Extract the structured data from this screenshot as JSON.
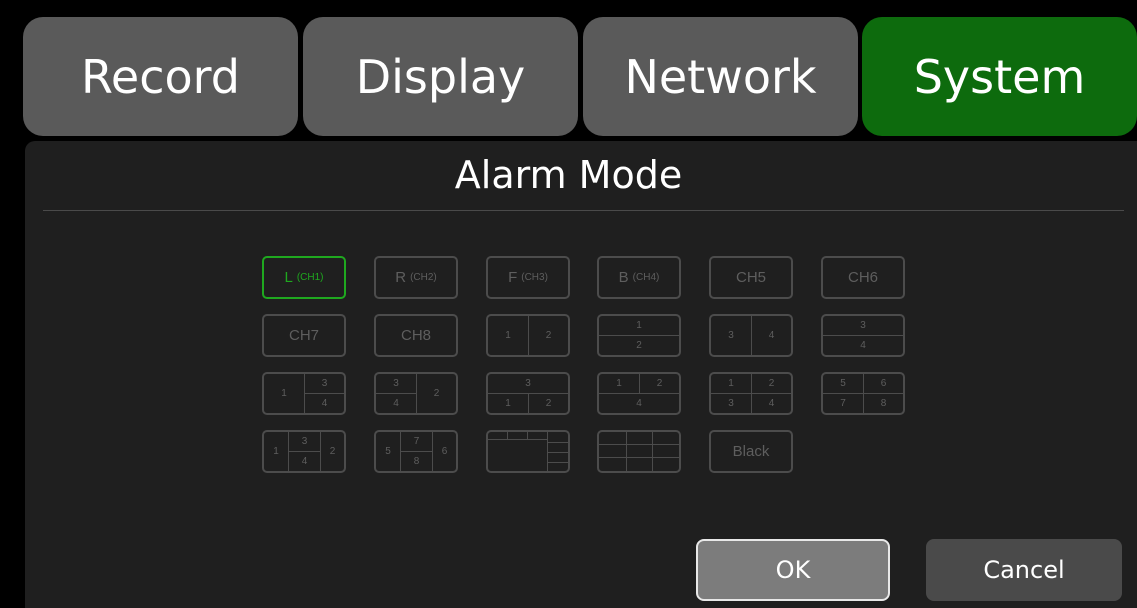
{
  "tabs": [
    "Record",
    "Display",
    "Network",
    "System"
  ],
  "active_tab": "System",
  "title": "Alarm Mode",
  "options": {
    "ch1": {
      "main": "L",
      "sub": "(CH1)"
    },
    "ch2": {
      "main": "R",
      "sub": "(CH2)"
    },
    "ch3": {
      "main": "F",
      "sub": "(CH3)"
    },
    "ch4": {
      "main": "B",
      "sub": "(CH4)"
    },
    "ch5": "CH5",
    "ch6": "CH6",
    "ch7": "CH7",
    "ch8": "CH8",
    "black": "Black"
  },
  "digits": [
    "1",
    "2",
    "3",
    "4",
    "5",
    "6",
    "7",
    "8"
  ],
  "selected": "L (CH1)",
  "buttons": {
    "ok": "OK",
    "cancel": "Cancel"
  },
  "colors": {
    "active_tab": "#0d6b0d",
    "selected": "#1fa81f"
  }
}
